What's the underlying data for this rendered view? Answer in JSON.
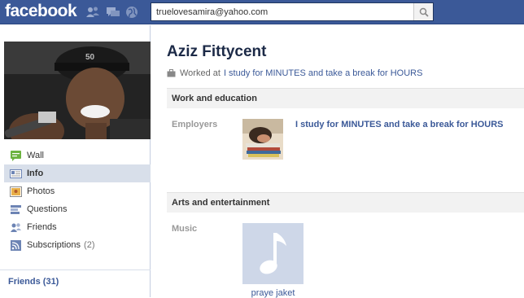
{
  "topbar": {
    "logo": "facebook",
    "search_value": "truelovesamira@yahoo.com",
    "jewels": [
      "friend-requests-icon",
      "messages-icon",
      "notifications-icon"
    ],
    "colors": {
      "bar": "#3b5998",
      "link": "#3b5998"
    }
  },
  "sidebar": {
    "items": [
      {
        "label": "Wall",
        "icon": "wall-icon"
      },
      {
        "label": "Info",
        "icon": "info-icon",
        "active": true
      },
      {
        "label": "Photos",
        "icon": "photos-icon"
      },
      {
        "label": "Questions",
        "icon": "questions-icon"
      },
      {
        "label": "Friends",
        "icon": "friends-icon"
      },
      {
        "label": "Subscriptions",
        "icon": "subscriptions-icon",
        "count": "(2)"
      }
    ],
    "friends_header": "Friends (31)"
  },
  "profile": {
    "name": "Aziz Fittycent",
    "worked_prefix": "Worked at",
    "worked_link": "I study for MINUTES and take a break for HOURS"
  },
  "sections": {
    "work": {
      "title": "Work and education",
      "label": "Employers",
      "employer": "I study for MINUTES and take a break for HOURS"
    },
    "arts": {
      "title": "Arts and entertainment",
      "label": "Music",
      "item": "praye jaket"
    }
  }
}
